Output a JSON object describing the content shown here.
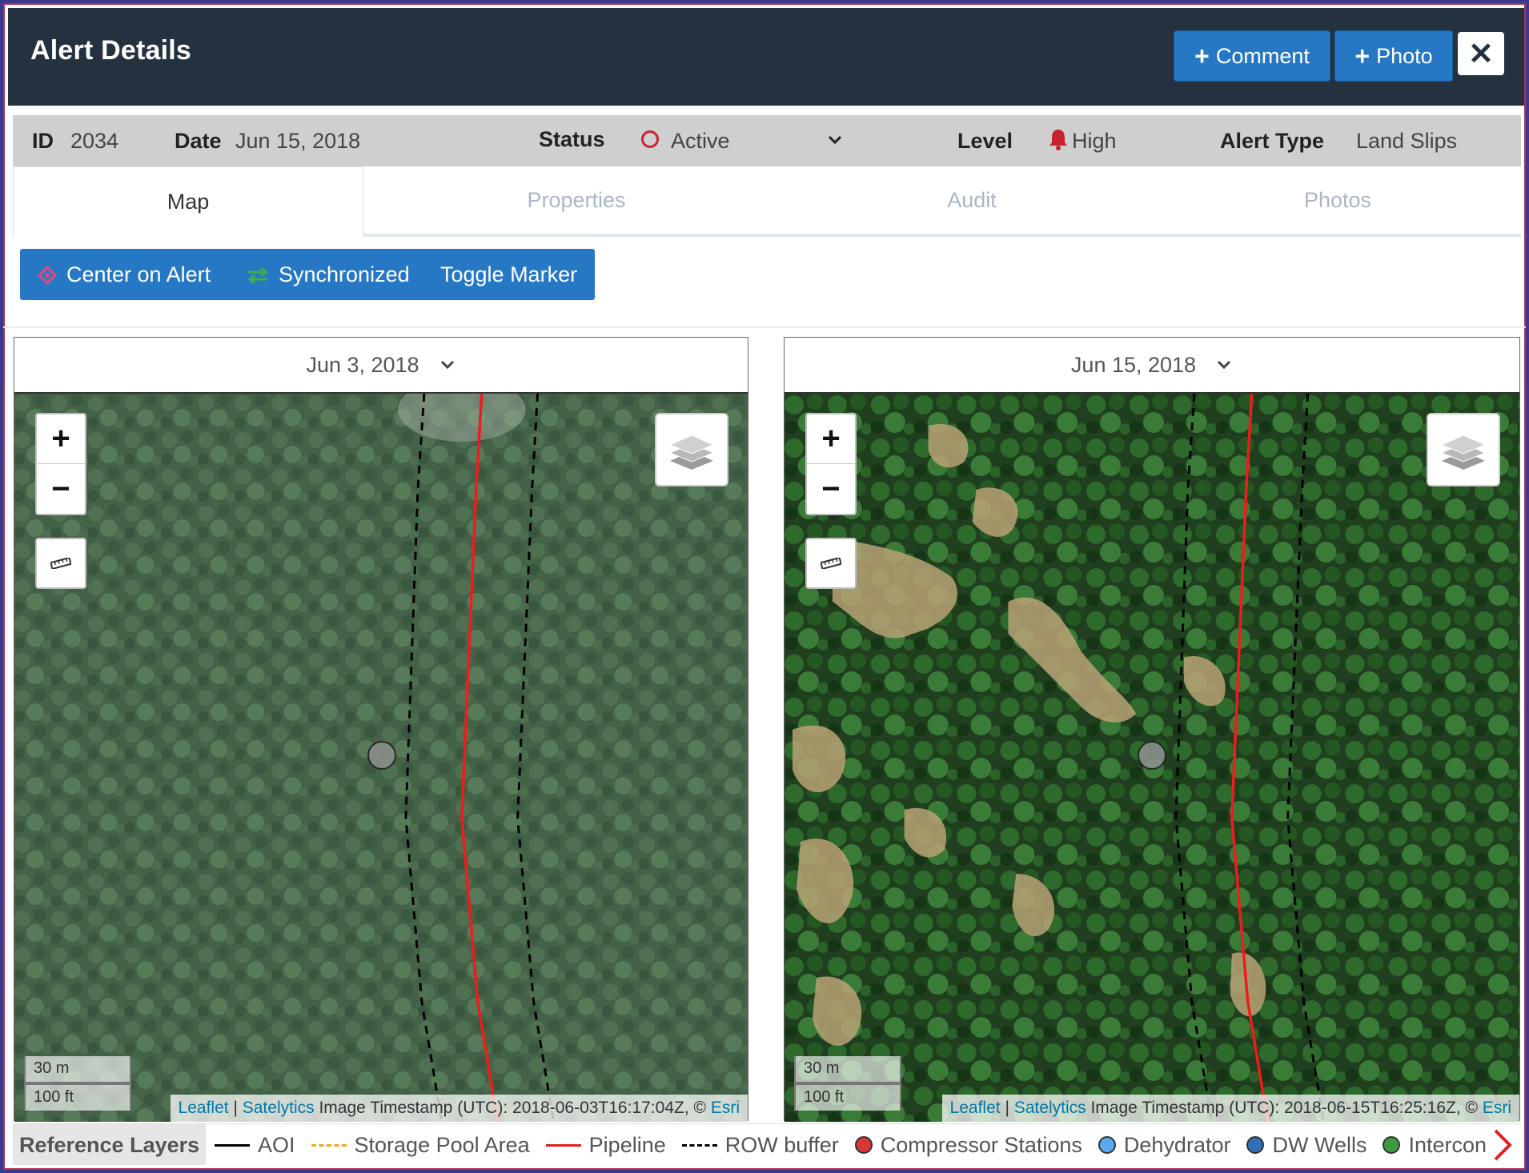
{
  "header": {
    "title": "Alert Details",
    "comment_label": "Comment",
    "photo_label": "Photo",
    "close_label": "✕"
  },
  "info": {
    "id_label": "ID",
    "id_value": "2034",
    "date_label": "Date",
    "date_value": "Jun 15, 2018",
    "status_label": "Status",
    "status_value": "Active",
    "level_label": "Level",
    "level_value": "High",
    "type_label": "Alert Type",
    "type_value": "Land Slips"
  },
  "tabs": [
    {
      "label": "Map"
    },
    {
      "label": "Properties"
    },
    {
      "label": "Audit"
    },
    {
      "label": "Photos"
    }
  ],
  "toolbar": {
    "center_label": "Center on Alert",
    "sync_label": "Synchronized",
    "toggle_label": "Toggle Marker"
  },
  "maps": [
    {
      "date": "Jun 3, 2018",
      "scale_m": "30 m",
      "scale_ft": "100 ft",
      "attrib_leaflet": "Leaflet",
      "attrib_sep": "|",
      "attrib_satelytics": "Satelytics",
      "attrib_text": "Image Timestamp (UTC): 2018-06-03T16:17:04Z, ©",
      "attrib_esri": "Esri"
    },
    {
      "date": "Jun 15, 2018",
      "scale_m": "30 m",
      "scale_ft": "100 ft",
      "attrib_leaflet": "Leaflet",
      "attrib_sep": "|",
      "attrib_satelytics": "Satelytics",
      "attrib_text": "Image Timestamp (UTC): 2018-06-15T16:25:16Z, ©",
      "attrib_esri": "Esri"
    }
  ],
  "legend": {
    "title": "Reference Layers",
    "items": [
      {
        "label": "AOI",
        "color": "#000000",
        "style": "solid"
      },
      {
        "label": "Storage Pool Area",
        "color": "#f5a623",
        "style": "dashed"
      },
      {
        "label": "Pipeline",
        "color": "#e02020",
        "style": "solid"
      },
      {
        "label": "ROW buffer",
        "color": "#000000",
        "style": "dashed"
      },
      {
        "label": "Compressor Stations",
        "color": "#d93636",
        "style": "dot"
      },
      {
        "label": "Dehydrator",
        "color": "#5aa9f0",
        "style": "dot"
      },
      {
        "label": "DW Wells",
        "color": "#2e6fb8",
        "style": "dot"
      },
      {
        "label": "Intercon",
        "color": "#3f9a3f",
        "style": "dot"
      }
    ]
  },
  "colors": {
    "header_bg": "#24313f",
    "accent": "#2778c4",
    "status_red": "#c8242f"
  }
}
